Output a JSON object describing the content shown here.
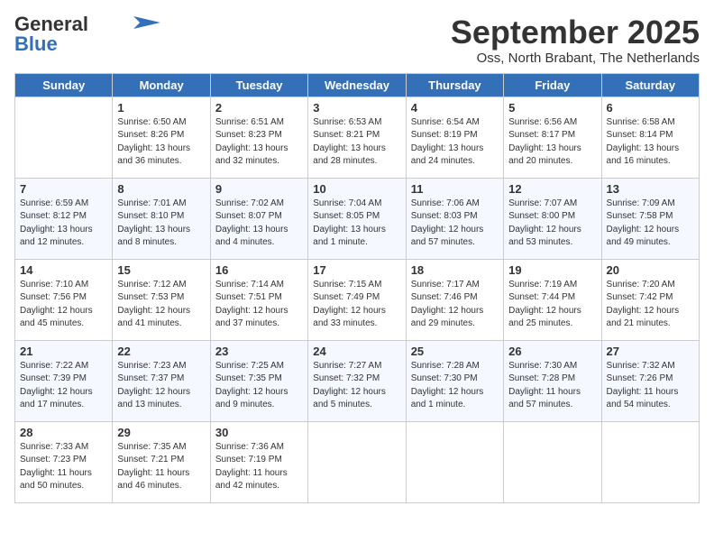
{
  "header": {
    "logo_line1": "General",
    "logo_line2": "Blue",
    "month_year": "September 2025",
    "location": "Oss, North Brabant, The Netherlands"
  },
  "columns": [
    "Sunday",
    "Monday",
    "Tuesday",
    "Wednesday",
    "Thursday",
    "Friday",
    "Saturday"
  ],
  "weeks": [
    [
      {
        "day": "",
        "info": ""
      },
      {
        "day": "1",
        "info": "Sunrise: 6:50 AM\nSunset: 8:26 PM\nDaylight: 13 hours\nand 36 minutes."
      },
      {
        "day": "2",
        "info": "Sunrise: 6:51 AM\nSunset: 8:23 PM\nDaylight: 13 hours\nand 32 minutes."
      },
      {
        "day": "3",
        "info": "Sunrise: 6:53 AM\nSunset: 8:21 PM\nDaylight: 13 hours\nand 28 minutes."
      },
      {
        "day": "4",
        "info": "Sunrise: 6:54 AM\nSunset: 8:19 PM\nDaylight: 13 hours\nand 24 minutes."
      },
      {
        "day": "5",
        "info": "Sunrise: 6:56 AM\nSunset: 8:17 PM\nDaylight: 13 hours\nand 20 minutes."
      },
      {
        "day": "6",
        "info": "Sunrise: 6:58 AM\nSunset: 8:14 PM\nDaylight: 13 hours\nand 16 minutes."
      }
    ],
    [
      {
        "day": "7",
        "info": "Sunrise: 6:59 AM\nSunset: 8:12 PM\nDaylight: 13 hours\nand 12 minutes."
      },
      {
        "day": "8",
        "info": "Sunrise: 7:01 AM\nSunset: 8:10 PM\nDaylight: 13 hours\nand 8 minutes."
      },
      {
        "day": "9",
        "info": "Sunrise: 7:02 AM\nSunset: 8:07 PM\nDaylight: 13 hours\nand 4 minutes."
      },
      {
        "day": "10",
        "info": "Sunrise: 7:04 AM\nSunset: 8:05 PM\nDaylight: 13 hours\nand 1 minute."
      },
      {
        "day": "11",
        "info": "Sunrise: 7:06 AM\nSunset: 8:03 PM\nDaylight: 12 hours\nand 57 minutes."
      },
      {
        "day": "12",
        "info": "Sunrise: 7:07 AM\nSunset: 8:00 PM\nDaylight: 12 hours\nand 53 minutes."
      },
      {
        "day": "13",
        "info": "Sunrise: 7:09 AM\nSunset: 7:58 PM\nDaylight: 12 hours\nand 49 minutes."
      }
    ],
    [
      {
        "day": "14",
        "info": "Sunrise: 7:10 AM\nSunset: 7:56 PM\nDaylight: 12 hours\nand 45 minutes."
      },
      {
        "day": "15",
        "info": "Sunrise: 7:12 AM\nSunset: 7:53 PM\nDaylight: 12 hours\nand 41 minutes."
      },
      {
        "day": "16",
        "info": "Sunrise: 7:14 AM\nSunset: 7:51 PM\nDaylight: 12 hours\nand 37 minutes."
      },
      {
        "day": "17",
        "info": "Sunrise: 7:15 AM\nSunset: 7:49 PM\nDaylight: 12 hours\nand 33 minutes."
      },
      {
        "day": "18",
        "info": "Sunrise: 7:17 AM\nSunset: 7:46 PM\nDaylight: 12 hours\nand 29 minutes."
      },
      {
        "day": "19",
        "info": "Sunrise: 7:19 AM\nSunset: 7:44 PM\nDaylight: 12 hours\nand 25 minutes."
      },
      {
        "day": "20",
        "info": "Sunrise: 7:20 AM\nSunset: 7:42 PM\nDaylight: 12 hours\nand 21 minutes."
      }
    ],
    [
      {
        "day": "21",
        "info": "Sunrise: 7:22 AM\nSunset: 7:39 PM\nDaylight: 12 hours\nand 17 minutes."
      },
      {
        "day": "22",
        "info": "Sunrise: 7:23 AM\nSunset: 7:37 PM\nDaylight: 12 hours\nand 13 minutes."
      },
      {
        "day": "23",
        "info": "Sunrise: 7:25 AM\nSunset: 7:35 PM\nDaylight: 12 hours\nand 9 minutes."
      },
      {
        "day": "24",
        "info": "Sunrise: 7:27 AM\nSunset: 7:32 PM\nDaylight: 12 hours\nand 5 minutes."
      },
      {
        "day": "25",
        "info": "Sunrise: 7:28 AM\nSunset: 7:30 PM\nDaylight: 12 hours\nand 1 minute."
      },
      {
        "day": "26",
        "info": "Sunrise: 7:30 AM\nSunset: 7:28 PM\nDaylight: 11 hours\nand 57 minutes."
      },
      {
        "day": "27",
        "info": "Sunrise: 7:32 AM\nSunset: 7:26 PM\nDaylight: 11 hours\nand 54 minutes."
      }
    ],
    [
      {
        "day": "28",
        "info": "Sunrise: 7:33 AM\nSunset: 7:23 PM\nDaylight: 11 hours\nand 50 minutes."
      },
      {
        "day": "29",
        "info": "Sunrise: 7:35 AM\nSunset: 7:21 PM\nDaylight: 11 hours\nand 46 minutes."
      },
      {
        "day": "30",
        "info": "Sunrise: 7:36 AM\nSunset: 7:19 PM\nDaylight: 11 hours\nand 42 minutes."
      },
      {
        "day": "",
        "info": ""
      },
      {
        "day": "",
        "info": ""
      },
      {
        "day": "",
        "info": ""
      },
      {
        "day": "",
        "info": ""
      }
    ]
  ]
}
